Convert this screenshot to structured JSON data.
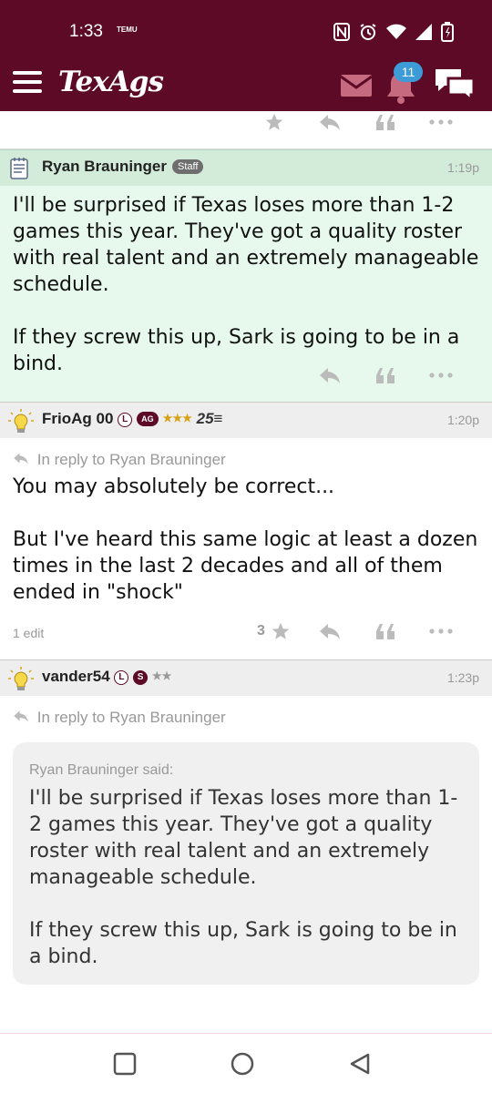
{
  "status_bar": {
    "time": "1:33",
    "carrier_mark": "TEMU"
  },
  "header": {
    "app_title": "TexAgs",
    "notification_count": "11"
  },
  "posts": [
    {
      "author": "Ryan Brauninger",
      "badge": "Staff",
      "time": "1:19p",
      "paragraphs": [
        "I'll be surprised if Texas loses more than 1-2 games this year. They've got a quality roster with real talent and an extremely manageable schedule.",
        "If they screw this up, Sark is going to be in a bind."
      ]
    },
    {
      "author": "FrioAg 00",
      "badge_l": "L",
      "badge_ag": "AG",
      "stars": "★★★",
      "rank": "25",
      "time": "1:20p",
      "reply_to": "In reply to Ryan Brauninger",
      "paragraphs": [
        "You may absolutely be correct...",
        "But I've heard this same logic at least a dozen times in the last 2 decades and all of them ended in \"shock\""
      ],
      "edit_note": "1 edit",
      "like_count": "3"
    },
    {
      "author": "vander54",
      "badge_l": "L",
      "badge_s": "S",
      "stars": "★★",
      "time": "1:23p",
      "reply_to": "In reply to Ryan Brauninger",
      "quote": {
        "author": "Ryan Brauninger said:",
        "paragraphs": [
          "I'll be surprised if Texas loses more than 1-2 games this year. They've got a quality roster with real talent and an extremely manageable schedule.",
          "If they screw this up, Sark is going to be in a bind."
        ]
      }
    }
  ],
  "colors": {
    "brand": "#5c0a26",
    "staff_highlight": "#e6f9ec",
    "badge_blue": "#3d9bd8"
  },
  "icons": [
    "menu-icon",
    "mail-icon",
    "bell-icon",
    "chat-icon",
    "star-icon",
    "reply-icon",
    "quote-icon",
    "more-icon",
    "arrow-reply-icon",
    "square-icon",
    "circle-icon",
    "back-triangle-icon"
  ]
}
